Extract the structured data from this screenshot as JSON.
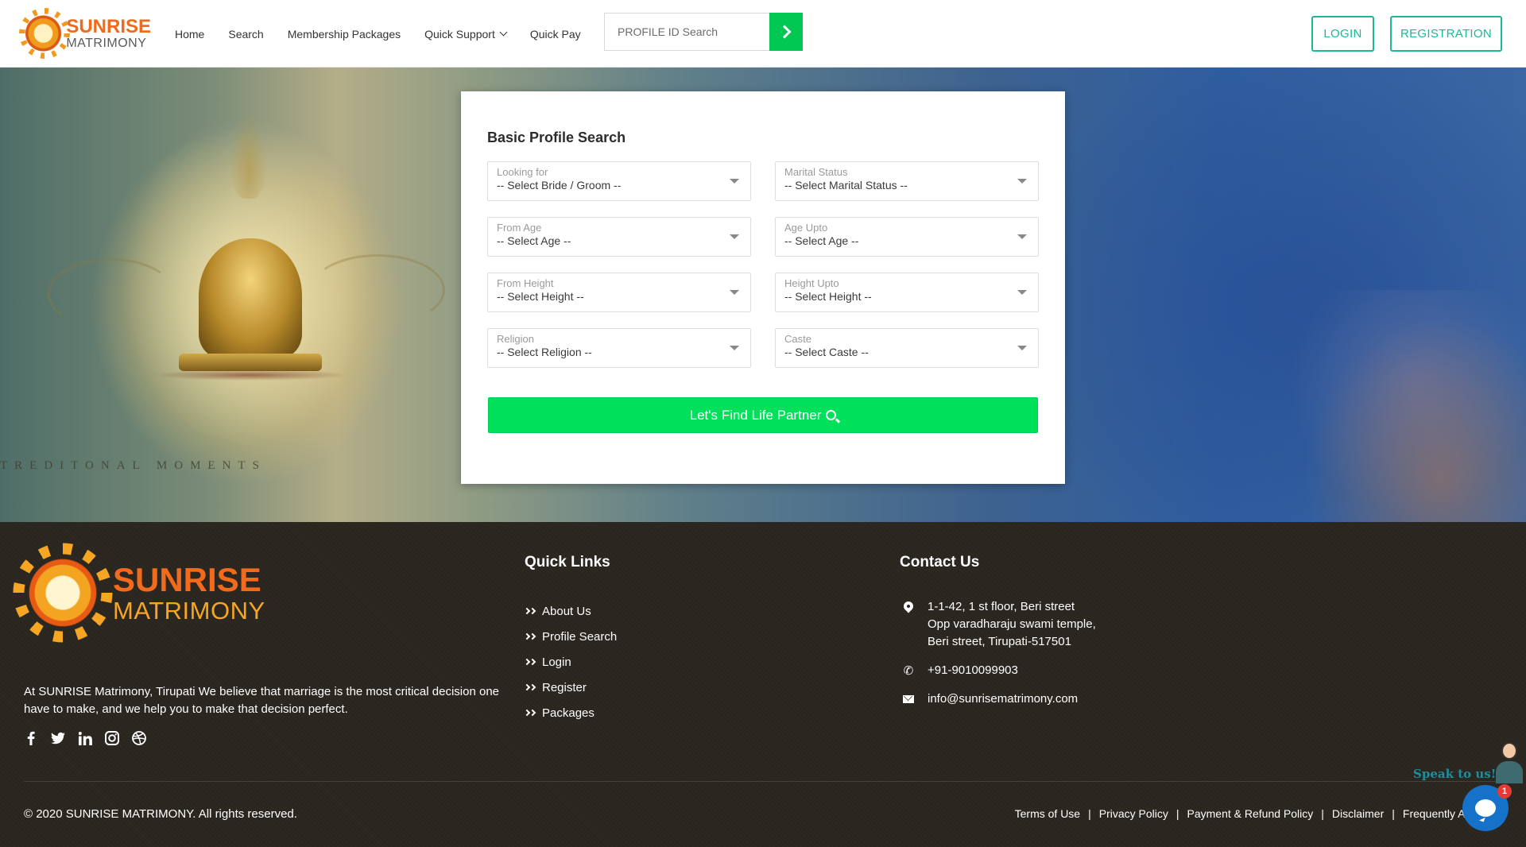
{
  "header": {
    "logo": {
      "line1": "SUNRISE",
      "line2": "MATRIMONY"
    },
    "nav": {
      "home": "Home",
      "search": "Search",
      "membership": "Membership Packages",
      "quick_support": "Quick Support",
      "quick_pay": "Quick Pay"
    },
    "profile_search": {
      "placeholder": "PROFILE ID Search"
    },
    "login": "LOGIN",
    "registration": "REGISTRATION"
  },
  "hero": {
    "caption": "TREDITONAL MOMENTS"
  },
  "search_panel": {
    "title": "Basic Profile Search",
    "fields": {
      "looking_for": {
        "label": "Looking for",
        "value": "-- Select Bride / Groom --"
      },
      "marital_status": {
        "label": "Marital Status",
        "value": "-- Select Marital Status --"
      },
      "from_age": {
        "label": "From Age",
        "value": "-- Select Age --"
      },
      "age_upto": {
        "label": "Age Upto",
        "value": "-- Select Age --"
      },
      "from_height": {
        "label": "From Height",
        "value": "-- Select Height --"
      },
      "height_upto": {
        "label": "Height Upto",
        "value": "-- Select Height --"
      },
      "religion": {
        "label": "Religion",
        "value": "-- Select Religion --"
      },
      "caste": {
        "label": "Caste",
        "value": "-- Select Caste --"
      }
    },
    "submit": "Let's Find Life Partner"
  },
  "footer": {
    "logo": {
      "line1": "SUNRISE",
      "line2": "MATRIMONY"
    },
    "about": "At SUNRISE Matrimony, Tirupati We believe that marriage is the most critical decision one have to make, and we help you to make that decision perfect.",
    "social": [
      "facebook-icon",
      "twitter-icon",
      "linkedin-icon",
      "instagram-icon",
      "dribbble-icon"
    ],
    "quick_links": {
      "heading": "Quick Links",
      "items": [
        "About Us",
        "Profile Search",
        "Login",
        "Register",
        "Packages"
      ]
    },
    "contact": {
      "heading": "Contact Us",
      "address": {
        "line1": "1-1-42, 1 st floor, Beri street",
        "line2": "Opp varadharaju swami temple,",
        "line3": "Beri street, Tirupati-517501"
      },
      "phone": "+91-9010099903",
      "email": "info@sunrisematrimony.com"
    },
    "copyright": "© 2020 SUNRISE MATRIMONY. All rights reserved.",
    "legal": {
      "terms": "Terms of Use",
      "privacy": "Privacy Policy",
      "refund": "Payment & Refund Policy",
      "disclaimer": "Disclaimer",
      "faq": "Frequently Asked Questions"
    }
  },
  "chat": {
    "speak": "Speak to us!",
    "badge": "1"
  },
  "colors": {
    "accent_green": "#00e05a",
    "outline_teal": "#18b996",
    "brand_orange": "#ef6a1b"
  }
}
